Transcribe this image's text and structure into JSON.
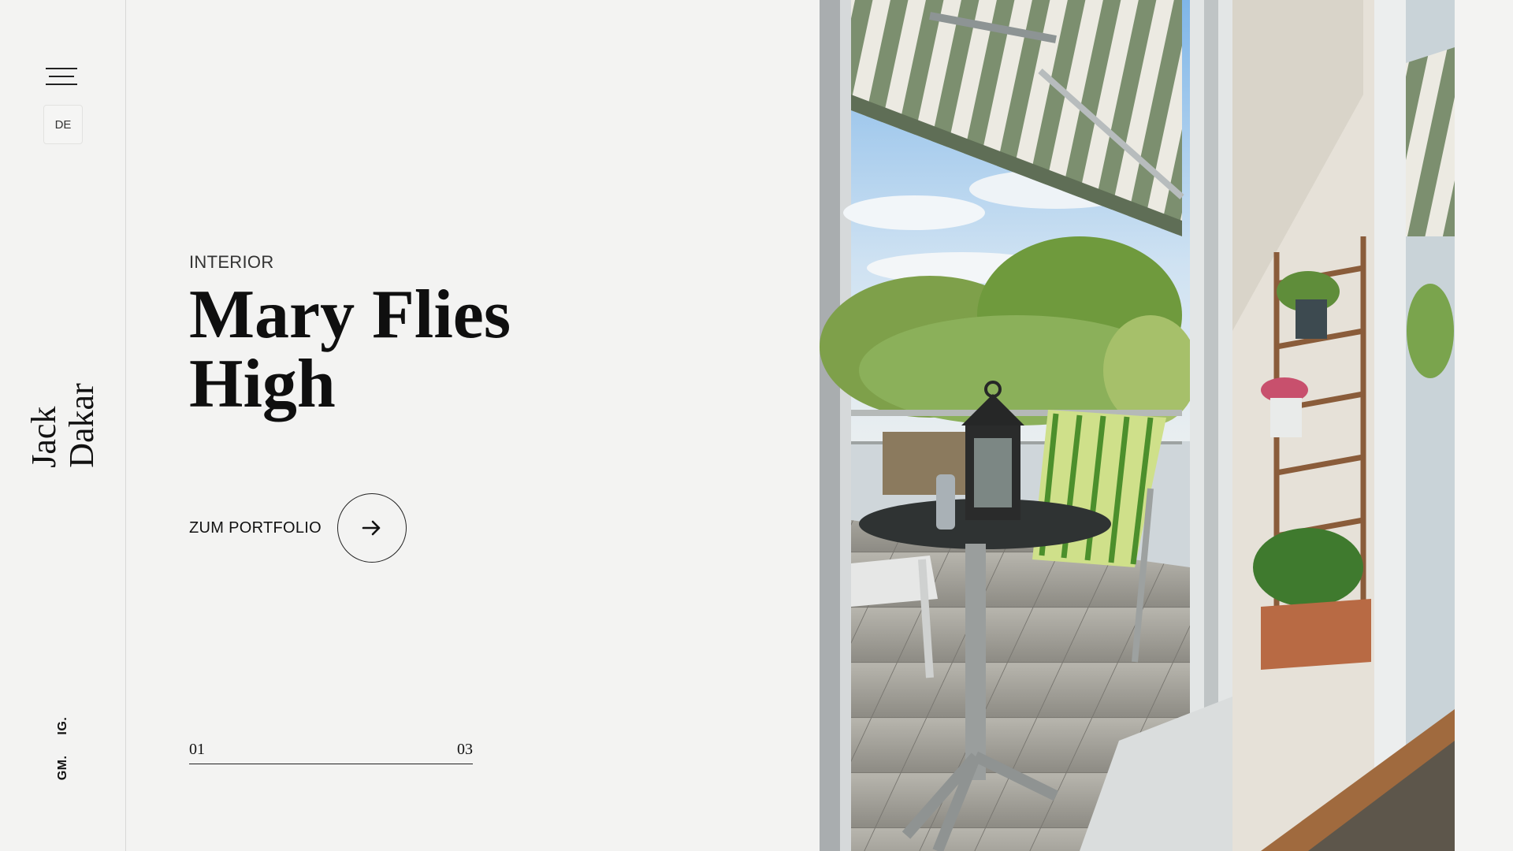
{
  "sidebar": {
    "menu_icon": "hamburger-icon",
    "language": "DE",
    "brand_line1": "Jack",
    "brand_line2": "Dakar",
    "social": [
      {
        "label": "GM."
      },
      {
        "label": "IG."
      }
    ]
  },
  "hero": {
    "category": "INTERIOR",
    "title_line1": "Mary Flies",
    "title_line2": "High",
    "cta_label": "ZUM PORTFOLIO",
    "cta_icon": "arrow-right-icon"
  },
  "slider": {
    "start": "01",
    "end": "03",
    "progress": 1.0
  },
  "image": {
    "subject": "balcony-with-table-and-chairs-photo"
  },
  "colors": {
    "background": "#f3f3f2",
    "text": "#111111",
    "divider": "#d8d8d6"
  }
}
